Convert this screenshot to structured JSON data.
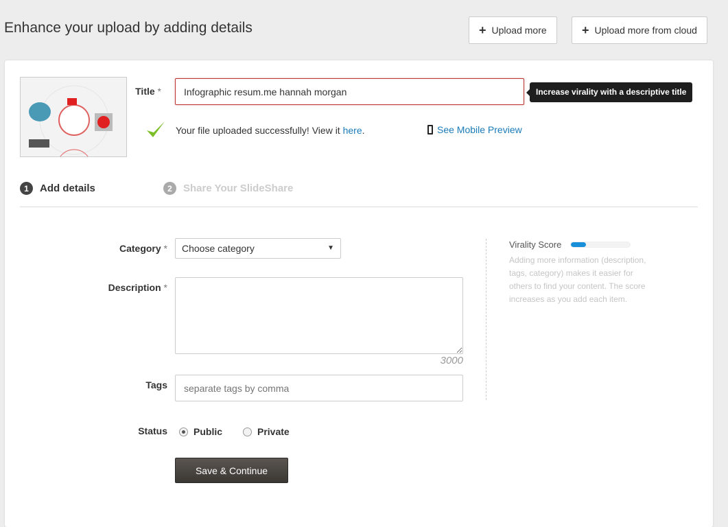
{
  "header": {
    "title": "Enhance your upload by adding details",
    "upload_more": "Upload more",
    "upload_cloud": "Upload more from cloud"
  },
  "title_field": {
    "label": "Title",
    "required": "*",
    "value": "Infographic resum.me hannah morgan",
    "tooltip": "Increase virality with a descriptive title"
  },
  "upload_status": {
    "message": "Your file uploaded successfully! View it ",
    "link": "here",
    "period": ".",
    "mobile_preview": "See Mobile Preview"
  },
  "steps": [
    {
      "num": "1",
      "label": "Add details"
    },
    {
      "num": "2",
      "label": "Share Your SlideShare"
    }
  ],
  "form": {
    "category": {
      "label": "Category",
      "required": "*",
      "value": "Choose category"
    },
    "description": {
      "label": "Description",
      "required": "*",
      "value": "",
      "counter": "3000"
    },
    "tags": {
      "label": "Tags",
      "placeholder": "separate tags by comma"
    },
    "status": {
      "label": "Status",
      "options": [
        "Public",
        "Private"
      ],
      "selected": "Public"
    },
    "save": "Save & Continue"
  },
  "virality": {
    "label": "Virality Score",
    "percent": 25,
    "color": "#1a8fd9",
    "help": "Adding more information (description, tags, category) makes it easier for others to find your content. The score increases as you add each item."
  }
}
